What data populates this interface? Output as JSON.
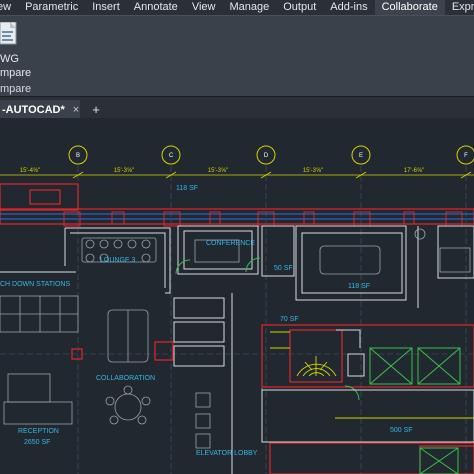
{
  "ribbon": {
    "tabs": [
      {
        "label": "ew",
        "active": false
      },
      {
        "label": "Parametric",
        "active": false
      },
      {
        "label": "Insert",
        "active": false
      },
      {
        "label": "Annotate",
        "active": false
      },
      {
        "label": "View",
        "active": false
      },
      {
        "label": "Manage",
        "active": false
      },
      {
        "label": "Output",
        "active": false
      },
      {
        "label": "Add-ins",
        "active": false
      },
      {
        "label": "Collaborate",
        "active": true
      },
      {
        "label": "Express Tools",
        "active": false
      }
    ],
    "panel": {
      "button_line1": "WG",
      "button_line2": "mpare",
      "title": "mpare"
    }
  },
  "document_tab": {
    "label": "-AUTOCAD*",
    "close": "×",
    "add": "+"
  },
  "drawing": {
    "grid_bubbles": [
      "B",
      "C",
      "D",
      "E",
      "F"
    ],
    "dimensions": [
      "15'-4⅝\"",
      "15'-3⅝\"",
      "15'-3⅝\"",
      "15'-3⅝\"",
      "17'-6⅝\""
    ],
    "rooms": {
      "area_118_top": "118 SF",
      "conference": "CONFERENCE",
      "lounge": "LOUNGE 3",
      "area_50": "50 SF",
      "area_118_right": "118 SF",
      "touchdown": "CH DOWN STATIONS",
      "area_70": "70 SF",
      "collaboration": "COLLABORATION",
      "reception": "RECEPTION",
      "reception_area": "2650 SF",
      "area_500": "500 SF",
      "elevator_lobby": "ELEVATOR LOBBY"
    }
  }
}
